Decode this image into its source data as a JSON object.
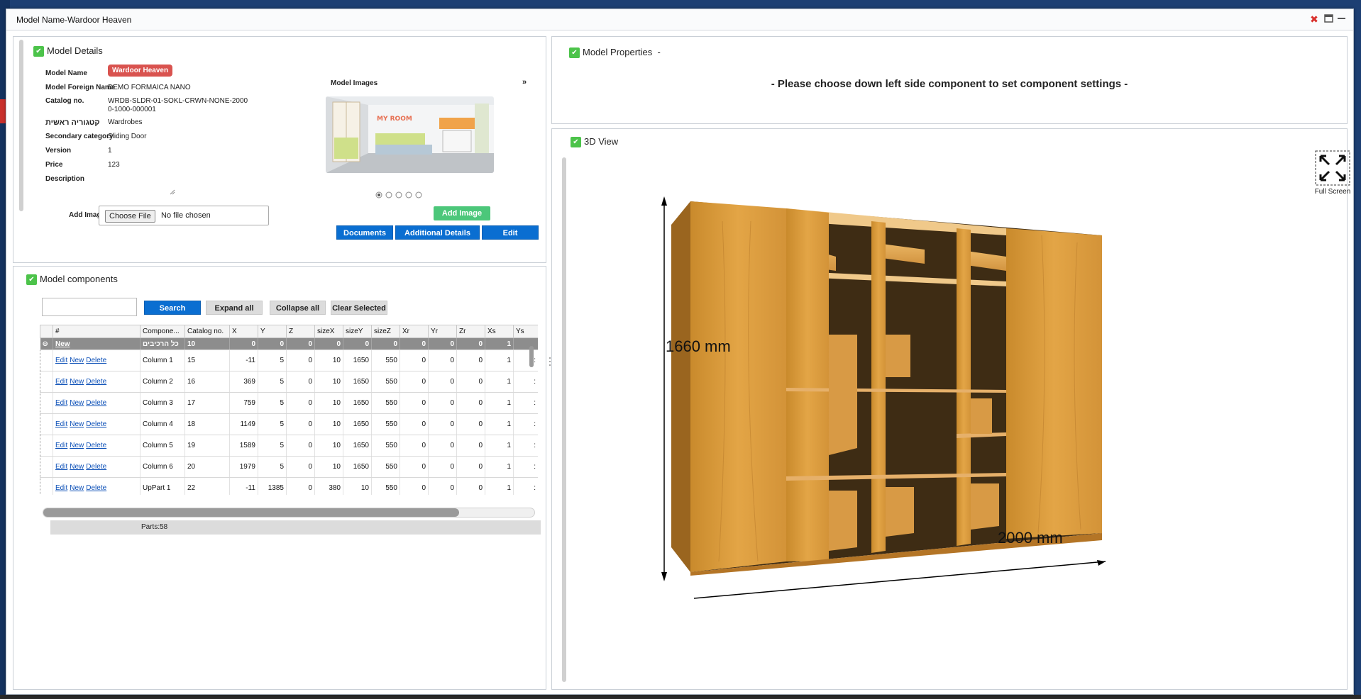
{
  "window": {
    "title": "Model Name-Wardoor Heaven"
  },
  "colors": {
    "accent": "#0a6ed1",
    "badge": "#d9534f",
    "check": "#4cc34a",
    "wood": "#d9952e"
  },
  "model_details": {
    "section_title": "Model Details",
    "fields": [
      {
        "label": "Model Name",
        "value": "Wardoor Heaven"
      },
      {
        "label": "Model Foreign Name",
        "value": "DEMO FORMAICA NANO"
      },
      {
        "label": "Catalog no.",
        "value": "WRDB-SLDR-01-SOKL-CRWN-NONE-20000-1000-000001"
      },
      {
        "label": "קטגוריה ראשית",
        "value": "Wardrobes"
      },
      {
        "label": "Secondary category",
        "value": "Sliding Door"
      },
      {
        "label": "Version",
        "value": "1"
      },
      {
        "label": "Price",
        "value": "123"
      },
      {
        "label": "Description",
        "value": ""
      }
    ],
    "add_image_label": "Add Image",
    "choose_file": "Choose File",
    "no_file": "No file chosen",
    "images_title": "Model Images",
    "image_logo": "MY ROOM",
    "add_image_button": "Add Image",
    "documents_button": "Documents",
    "additional_details_button": "Additional Details",
    "edit_button": "Edit",
    "carousel_dots": 5
  },
  "model_properties": {
    "section_title": "Model Properties",
    "dash": "-",
    "message": "- Please choose down left side component to set component settings -"
  },
  "view3d": {
    "section_title": "3D View",
    "full_screen": "Full Screen",
    "height_label": "1660 mm",
    "width_label": "2000 mm"
  },
  "components": {
    "section_title": "Model components",
    "search_placeholder": "",
    "search_button": "Search",
    "expand_all": "Expand all",
    "collapse_all": "Collapse all",
    "clear_selected": "Clear Selected",
    "columns": [
      "#",
      "Compone...",
      "Catalog no.",
      "X",
      "Y",
      "Z",
      "sizeX",
      "sizeY",
      "sizeZ",
      "Xr",
      "Yr",
      "Zr",
      "Xs",
      "Ys"
    ],
    "group_row": {
      "action": "New",
      "name": "כל הרכיבים",
      "catalog": "10",
      "values": [
        "0",
        "0",
        "0",
        "0",
        "0",
        "0",
        "0",
        "0",
        "0",
        "1",
        ""
      ]
    },
    "row_actions": {
      "edit": "Edit",
      "new": "New",
      "delete": "Delete"
    },
    "rows": [
      {
        "name": "Column 1",
        "catalog": "15",
        "values": [
          "-11",
          "5",
          "0",
          "10",
          "1650",
          "550",
          "0",
          "0",
          "0",
          "1",
          ":"
        ]
      },
      {
        "name": "Column 2",
        "catalog": "16",
        "values": [
          "369",
          "5",
          "0",
          "10",
          "1650",
          "550",
          "0",
          "0",
          "0",
          "1",
          ":"
        ]
      },
      {
        "name": "Column 3",
        "catalog": "17",
        "values": [
          "759",
          "5",
          "0",
          "10",
          "1650",
          "550",
          "0",
          "0",
          "0",
          "1",
          ":"
        ]
      },
      {
        "name": "Column 4",
        "catalog": "18",
        "values": [
          "1149",
          "5",
          "0",
          "10",
          "1650",
          "550",
          "0",
          "0",
          "0",
          "1",
          ":"
        ]
      },
      {
        "name": "Column 5",
        "catalog": "19",
        "values": [
          "1589",
          "5",
          "0",
          "10",
          "1650",
          "550",
          "0",
          "0",
          "0",
          "1",
          ":"
        ]
      },
      {
        "name": "Column 6",
        "catalog": "20",
        "values": [
          "1979",
          "5",
          "0",
          "10",
          "1650",
          "550",
          "0",
          "0",
          "0",
          "1",
          ":"
        ]
      },
      {
        "name": "UpPart 1",
        "catalog": "22",
        "values": [
          "-11",
          "1385",
          "0",
          "380",
          "10",
          "550",
          "0",
          "0",
          "0",
          "1",
          ":"
        ]
      }
    ],
    "parts_label": "Parts:58"
  }
}
